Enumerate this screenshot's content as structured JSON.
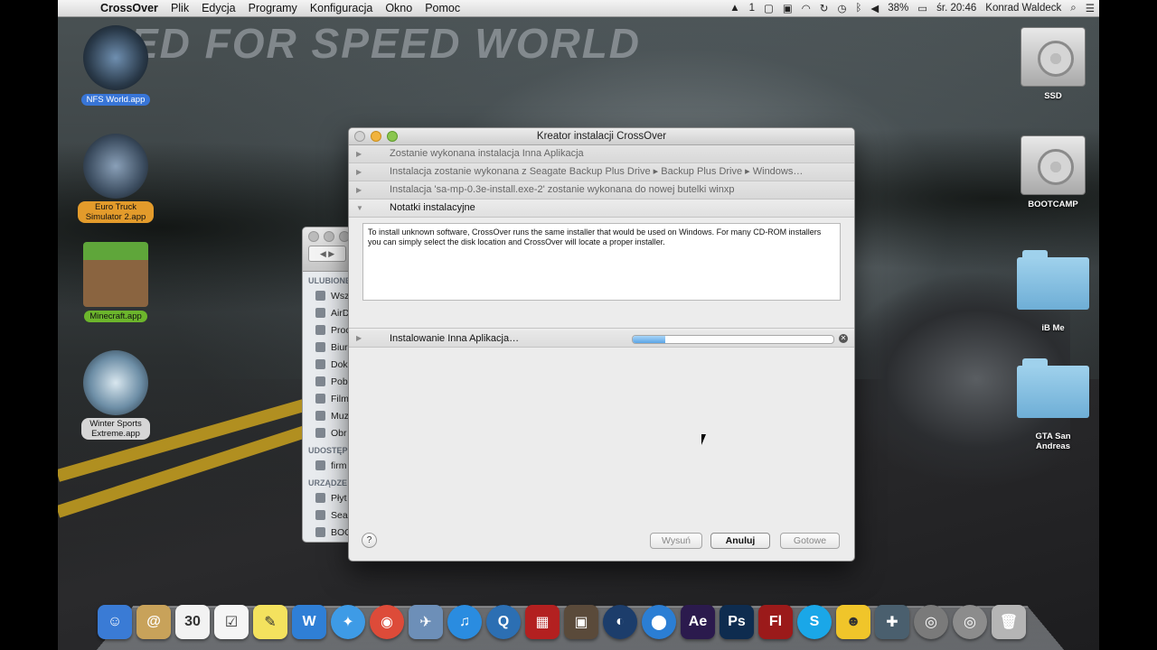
{
  "menubar": {
    "app_name": "CrossOver",
    "items": [
      "Plik",
      "Edycja",
      "Programy",
      "Konfiguracja",
      "Okno",
      "Pomoc"
    ],
    "status": {
      "battery": "38%",
      "clock": "śr. 20:46",
      "user": "Konrad Waldeck",
      "badge": "1"
    }
  },
  "desktop_left": [
    {
      "label": "NFS World.app",
      "style": "sel"
    },
    {
      "label": "Euro Truck Simulator 2.app",
      "style": "org"
    },
    {
      "label": "Minecraft.app",
      "style": "grn"
    },
    {
      "label": "Winter Sports Extreme.app",
      "style": "gry"
    }
  ],
  "desktop_right": [
    {
      "label": "SSD",
      "kind": "drive"
    },
    {
      "label": "BOOTCAMP",
      "kind": "drive"
    },
    {
      "label": "iB Me",
      "kind": "folder"
    },
    {
      "label": "GTA San Andreas",
      "kind": "folder"
    }
  ],
  "wallpaper_text": "ED FOR SPEED WORLD",
  "finder": {
    "sections": [
      {
        "title": "ULUBIONE",
        "rows": [
          "Wsz",
          "AirD",
          "Proc",
          "Biur",
          "Dok",
          "Pob",
          "Film",
          "Muz",
          "Obr"
        ]
      },
      {
        "title": "UDOSTĘP",
        "rows": [
          "firm"
        ]
      },
      {
        "title": "URZĄDZE",
        "rows": [
          "Płyt",
          "Sea",
          "BOO"
        ]
      }
    ]
  },
  "dialog": {
    "title": "Kreator instalacji CrossOver",
    "steps": [
      "Zostanie wykonana instalacja Inna Aplikacja",
      "Instalacja zostanie wykonana z Seagate Backup Plus Drive ▸ Backup Plus Drive ▸ Windows…",
      "Instalacja 'sa-mp-0.3e-install.exe-2' zostanie wykonana do nowej butelki winxp"
    ],
    "notes_header": "Notatki instalacyjne",
    "notes_text": "To install unknown software, CrossOver runs the same installer that would be used on Windows. For many CD-ROM installers you can simply select the disk location and CrossOver will locate a proper installer.",
    "progress_label": "Instalowanie Inna Aplikacja…",
    "progress_fraction": 0.16,
    "buttons": {
      "eject": "Wysuń",
      "cancel": "Anuluj",
      "done": "Gotowe"
    },
    "help": "?"
  },
  "dock": [
    {
      "name": "finder",
      "glyph": "☺",
      "color": "#3a7bd5"
    },
    {
      "name": "contacts",
      "glyph": "@",
      "color": "#c8a25a"
    },
    {
      "name": "calendar",
      "glyph": "30",
      "color": "#f2f2f2"
    },
    {
      "name": "reminders",
      "glyph": "☑",
      "color": "#f5f5f5"
    },
    {
      "name": "stickies",
      "glyph": "✎",
      "color": "#f4e25e"
    },
    {
      "name": "word",
      "glyph": "W",
      "color": "#2f7fd6"
    },
    {
      "name": "safari",
      "glyph": "✦",
      "color": "#3e9be6"
    },
    {
      "name": "chrome",
      "glyph": "◉",
      "color": "#dd4b39"
    },
    {
      "name": "preview",
      "glyph": "✈",
      "color": "#6d8fb8"
    },
    {
      "name": "itunes",
      "glyph": "♫",
      "color": "#2a8ce0"
    },
    {
      "name": "quicktime",
      "glyph": "Q",
      "color": "#2c6fb3"
    },
    {
      "name": "photo-booth",
      "glyph": "▦",
      "color": "#b32020"
    },
    {
      "name": "iphoto",
      "glyph": "▣",
      "color": "#5a4a3a"
    },
    {
      "name": "cinema4d",
      "glyph": "◐",
      "color": "#1c3d6b"
    },
    {
      "name": "ball",
      "glyph": "⬤",
      "color": "#2b7ed4"
    },
    {
      "name": "after-effects",
      "glyph": "Ae",
      "color": "#2b1a4d"
    },
    {
      "name": "photoshop",
      "glyph": "Ps",
      "color": "#0e2c4f"
    },
    {
      "name": "flash",
      "glyph": "Fl",
      "color": "#9b1a1a"
    },
    {
      "name": "skype",
      "glyph": "S",
      "color": "#1aa7e8"
    },
    {
      "name": "smiley",
      "glyph": "☻",
      "color": "#f0c52a"
    },
    {
      "name": "utility",
      "glyph": "✚",
      "color": "#4a5f6e"
    },
    {
      "name": "crossover",
      "glyph": "◎",
      "color": "#7a7a7a"
    },
    {
      "name": "downloads",
      "glyph": "◎",
      "color": "#8c8c8c"
    },
    {
      "name": "trash",
      "glyph": "🗑",
      "color": "#b5b5b5"
    }
  ]
}
